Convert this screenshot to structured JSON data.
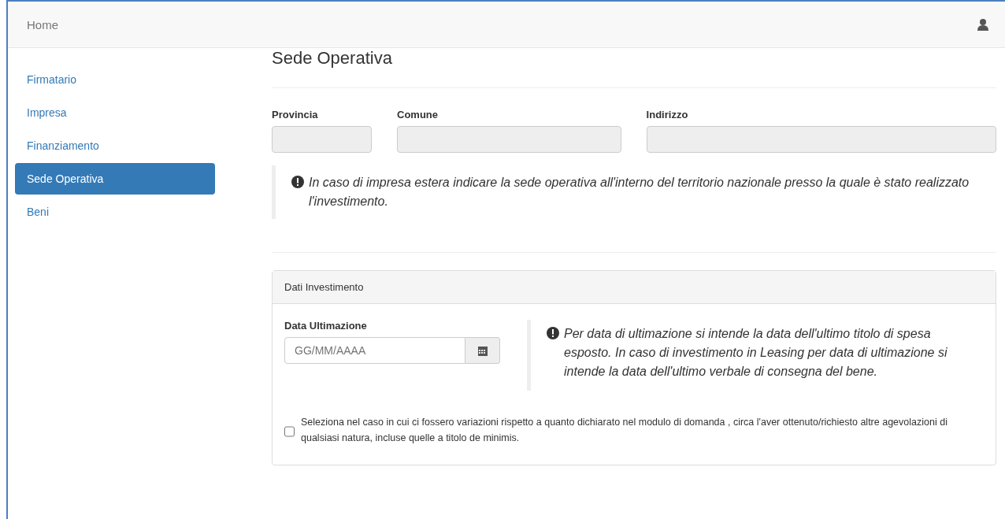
{
  "navbar": {
    "brand": "Home"
  },
  "sidebar": {
    "items": [
      {
        "label": "Firmatario",
        "selected": false
      },
      {
        "label": "Impresa",
        "selected": false
      },
      {
        "label": "Finanziamento",
        "selected": false
      },
      {
        "label": "Sede Operativa",
        "selected": true
      },
      {
        "label": "Beni",
        "selected": false
      }
    ]
  },
  "section": {
    "title": "Sede Operativa",
    "fields": [
      {
        "label": "Provincia",
        "disabled": true
      },
      {
        "label": "Comune",
        "disabled": true
      },
      {
        "label": "Indirizzo",
        "disabled": true
      }
    ],
    "note": "In caso di impresa estera indicare la sede operativa all'interno del territorio nazionale presso la quale è stato realizzato l'investimento."
  },
  "panel": {
    "title": "Dati Investimento",
    "date_field": {
      "label": "Data Ultimazione",
      "placeholder": "GG/MM/AAAA"
    },
    "note": "Per data di ultimazione si intende la data dell'ultimo titolo di spesa esposto. In caso di investimento in Leasing per data di ultimazione si intende la data dell'ultimo verbale di consegna del bene.",
    "checkbox": {
      "label": "Seleziona nel caso in cui ci fossero variazioni rispetto a quanto dichiarato nel modulo di domanda , circa l'aver ottenuto/richiesto altre agevolazioni di qualsiasi natura, incluse quelle a titolo de minimis.",
      "checked": false
    }
  }
}
